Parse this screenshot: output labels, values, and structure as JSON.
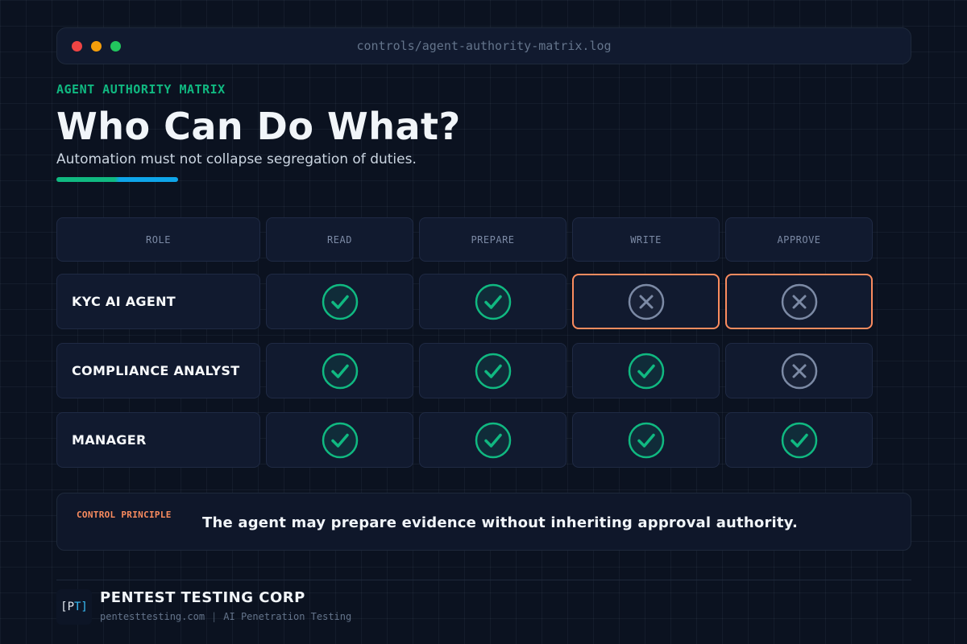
{
  "window": {
    "path": "controls/agent-authority-matrix.log"
  },
  "header": {
    "eyebrow": "AGENT AUTHORITY MATRIX",
    "title": "Who Can Do What?",
    "subtitle": "Automation must not collapse segregation of duties."
  },
  "matrix": {
    "columns": [
      "ROLE",
      "READ",
      "PREPARE",
      "WRITE",
      "APPROVE"
    ],
    "rows": [
      {
        "role": "KYC AI AGENT",
        "permissions": [
          true,
          true,
          false,
          false
        ],
        "flagged": [
          false,
          false,
          true,
          true
        ]
      },
      {
        "role": "COMPLIANCE ANALYST",
        "permissions": [
          true,
          true,
          true,
          false
        ],
        "flagged": [
          false,
          false,
          false,
          false
        ]
      },
      {
        "role": "MANAGER",
        "permissions": [
          true,
          true,
          true,
          true
        ],
        "flagged": [
          false,
          false,
          false,
          false
        ]
      }
    ]
  },
  "principle": {
    "label": "CONTROL PRINCIPLE",
    "text": "The agent may prepare evidence without inheriting approval authority."
  },
  "footer": {
    "logo_left": "[P",
    "logo_right": "T]",
    "company": "PENTEST TESTING CORP",
    "website": "pentesttesting.com",
    "separator": "|",
    "tagline": "AI Penetration Testing"
  },
  "colors": {
    "allowed": "#10b981",
    "denied": "#7c8aa5",
    "flag_border": "#fb8c5f"
  },
  "icons": {
    "allowed": "check-circle-icon",
    "denied": "x-circle-icon"
  }
}
